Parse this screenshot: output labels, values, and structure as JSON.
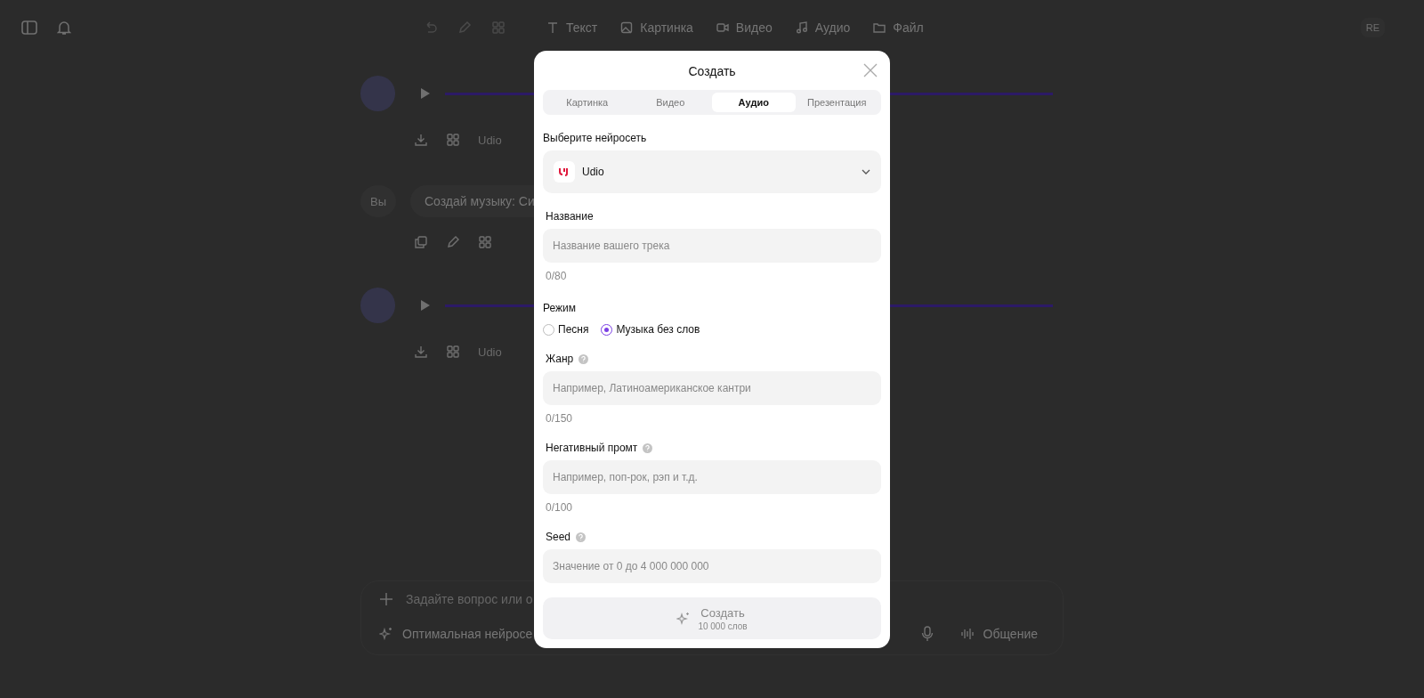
{
  "topbar": {
    "tools": [
      {
        "label": "Текст",
        "kind": "text"
      },
      {
        "label": "Картинка",
        "kind": "image"
      },
      {
        "label": "Видео",
        "kind": "video"
      },
      {
        "label": "Аудио",
        "kind": "audio"
      },
      {
        "label": "Файл",
        "kind": "file"
      }
    ],
    "avatar": "RE"
  },
  "chat": [
    {
      "kind": "audio",
      "model": "Udio"
    },
    {
      "kind": "user",
      "author": "Вы",
      "text": "Создай музыку: Си"
    },
    {
      "kind": "audio",
      "model": "Udio"
    }
  ],
  "composer": {
    "placeholder": "Задайте вопрос или о",
    "model": "Оптимальная нейросе",
    "mode": "Общение"
  },
  "dialog": {
    "title": "Создать",
    "tabs": [
      {
        "label": "Картинка",
        "selected": false
      },
      {
        "label": "Видео",
        "selected": false
      },
      {
        "label": "Аудио",
        "selected": true
      },
      {
        "label": "Презентация",
        "selected": false
      }
    ],
    "model_label": "Выберите нейросеть",
    "model": "Udio",
    "form": [
      {
        "kind": "text",
        "label": "Название",
        "help": false,
        "placeholder": "Название вашего трека",
        "counter": "0/80"
      },
      {
        "kind": "radio",
        "label": "Режим",
        "options": [
          {
            "label": "Песня",
            "selected": false
          },
          {
            "label": "Музыка без слов",
            "selected": true
          }
        ]
      },
      {
        "kind": "text",
        "label": "Жанр",
        "help": true,
        "placeholder": "Например, Латиноамериканское кантри",
        "counter": "0/150"
      },
      {
        "kind": "text",
        "label": "Негативный промт",
        "help": true,
        "placeholder": "Например, поп-рок, рэп и т.д.",
        "counter": "0/100"
      },
      {
        "kind": "text",
        "label": "Seed",
        "help": true,
        "placeholder": "Значение от 0 до 4 000 000 000"
      }
    ],
    "submit": {
      "label": "Создать",
      "cost": "10 000 слов"
    }
  }
}
